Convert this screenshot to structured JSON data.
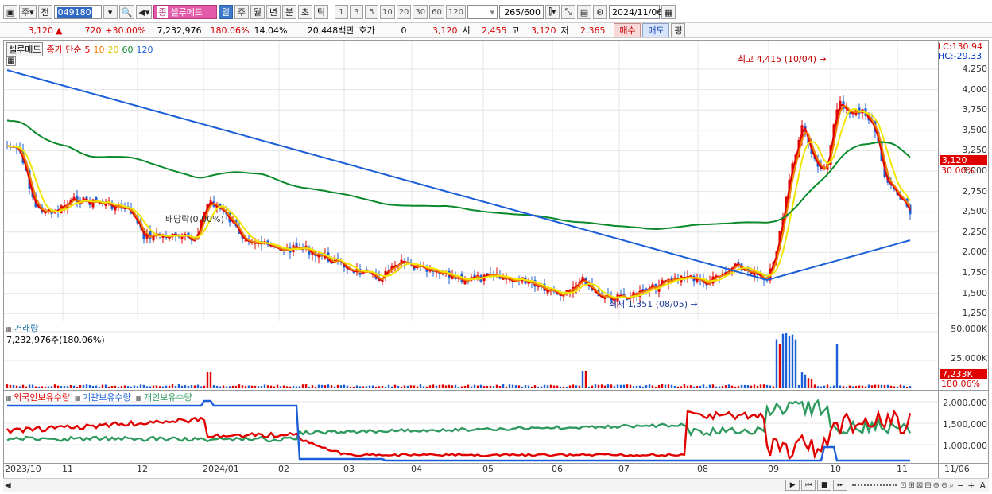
{
  "toolbar": {
    "type_label": "주",
    "prev_label": "전",
    "code": "049180",
    "stock_name": "셀루메드",
    "stock_badge": "종",
    "periods": [
      "일",
      "주",
      "월",
      "년",
      "분",
      "초",
      "틱"
    ],
    "period_active": "일",
    "intervals": [
      "1",
      "3",
      "5",
      "10",
      "20",
      "30",
      "60",
      "120"
    ],
    "count": "265",
    "count_total": "/600",
    "date": "2024/11/06"
  },
  "quote": {
    "price": "3,120",
    "change": "720",
    "change_pct": "+30.00%",
    "volume": "7,232,976",
    "vol_ratio": "180.06%",
    "turnover": "14.04%",
    "amount": "20,448백만",
    "hoga_label": "호가",
    "hoga_val": "0",
    "hoga_price": "3,120",
    "open_label": "시",
    "open": "2,455",
    "high_label": "고",
    "high": "3,120",
    "low_label": "저",
    "low": "2,365",
    "buy_label": "매수",
    "sell_label": "매도",
    "eval_label": "평"
  },
  "price_chart": {
    "name_box": "셀루메드",
    "legend_prefix": "종가 단순",
    "ma": [
      {
        "label": "5",
        "color": "#e00000"
      },
      {
        "label": "10",
        "color": "#f08000"
      },
      {
        "label": "20",
        "color": "#e8e000"
      },
      {
        "label": "60",
        "color": "#0a8a2a"
      },
      {
        "label": "120",
        "color": "#1a5fd8"
      }
    ],
    "lc": "LC:130.94",
    "hc": "HC:-29.33",
    "y_ticks": [
      "4,250",
      "4,000",
      "3,750",
      "3,500",
      "3,250",
      "3,000",
      "2,750",
      "2,500",
      "2,250",
      "2,000",
      "1,750",
      "1,500",
      "1,250"
    ],
    "high_note": "최고 4,415 (10/04)",
    "low_note": "최저 1,351 (08/05)",
    "dividend_note": "배당락(0.00%)",
    "last_price": "3,120",
    "last_pct": "30.00%"
  },
  "volume_chart": {
    "title": "거래량",
    "sub": "7,232,976주(180.06%)",
    "y_ticks": [
      "50,000K",
      "25,000K"
    ],
    "last": "7,233K",
    "last_pct": "180.06%"
  },
  "holding_chart": {
    "legend": [
      {
        "label": "외국인보유수량",
        "color": "#e00000"
      },
      {
        "label": "기관보유수량",
        "color": "#1a5fd8"
      },
      {
        "label": "개인보유수량",
        "color": "#2e9a5e"
      }
    ],
    "y_ticks": [
      "2,000,000",
      "1,500,000",
      "1,000,000"
    ]
  },
  "x_axis": [
    "2023/10",
    "11",
    "12",
    "2024/01",
    "02",
    "03",
    "04",
    "05",
    "06",
    "07",
    "08",
    "09",
    "10",
    "11"
  ],
  "x_axis_end": "11/06",
  "colors": {
    "up": "#e00000",
    "down": "#1a5fd8",
    "accent": "#316ac5"
  }
}
